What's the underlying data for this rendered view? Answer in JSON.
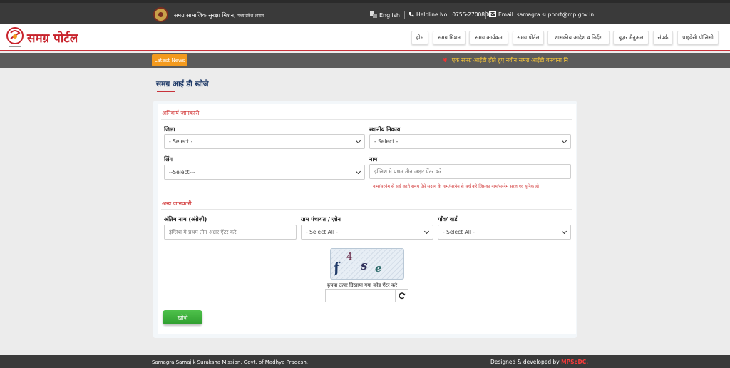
{
  "topbar": {
    "mission": "समग्र सामाजिक सुरक्षा मिशन,",
    "mission_sub": "मध्य प्रदेश शासन",
    "language": "English",
    "helpline": "Helpline No.: 0755-2700800",
    "email": "Email: samagra.support@mp.gov.in"
  },
  "header": {
    "logo_text": "समग्र पोर्टल",
    "nav": [
      "होम",
      "समग्र मिशन",
      "समग्र कार्यक्रम",
      "समग्र पोर्टल",
      "शासकीय आदेश व निर्देश",
      "यूज़र मैनुअल",
      "संपर्क",
      "प्राइवेसी पॉलिसी"
    ]
  },
  "news": {
    "badge": "Latest News",
    "ticker": "एक समग्र आईडी होते हुए नवीन समग्र आईडी बनवाना नि"
  },
  "page": {
    "title": "समग्र आई डी खोजे"
  },
  "form": {
    "mandatory_heading": "अनिवार्य जानकारी",
    "other_heading": "अन्य जानकारी",
    "district_label": "जिला",
    "district_value": "- Select -",
    "local_body_label": "स्थानीय निकाय",
    "local_body_value": "- Select -",
    "gender_label": "लिंग",
    "gender_value": "--Select---",
    "name_label": "नाम",
    "name_placeholder": "इंग्लिश मे प्रथम तीन अक्षर ऐंटर करे",
    "note": "नाम/सरनेम से सर्च करते समय ऐसे सदस्य के नाम/सरनेम से सर्च करे जिसका नाम/सरनेम सरल एवं यूनिक हो।",
    "surname_label": "अंतिम नाम (अंग्रेज़ी)",
    "surname_placeholder": "इंग्लिश मे प्रथम तीन अक्षर ऐंटर करे",
    "panchayat_label": "ग्राम पंचायत / ज़ोन",
    "panchayat_value": "- Select All -",
    "village_label": "गाँव/ वार्ड",
    "village_value": "- Select All -",
    "captcha_chars": [
      "f",
      "4",
      "s",
      "e"
    ],
    "captcha_hint": "कृपया ऊपर दिखाया गया कोड ऐंटर करे",
    "search_button": "खोजे"
  },
  "footer": {
    "left": "Samagra Samajik Suraksha Mission, Govt. of Madhya Pradesh.",
    "right_prefix": "Designed & developed by",
    "brand": "MPSeDC."
  },
  "colors": {
    "accent_red": "#c8323a",
    "news_badge": "#f39a1e",
    "button_green": "#3aae38",
    "title_blue": "#1f3a68"
  }
}
